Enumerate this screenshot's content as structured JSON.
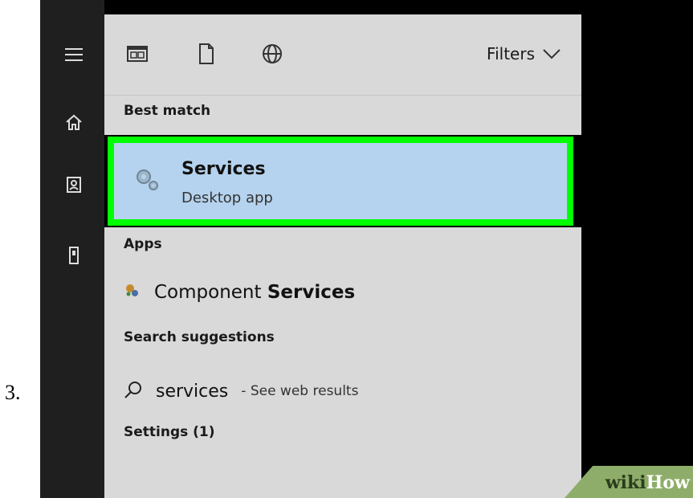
{
  "step_number": "3.",
  "rail_icons": [
    "hamburger-menu-icon",
    "home-icon",
    "contact-icon",
    "tower-icon"
  ],
  "toolbar": {
    "icons": [
      "apps-icon",
      "document-icon",
      "globe-icon"
    ],
    "filters_label": "Filters"
  },
  "sections": {
    "best_match": "Best match",
    "apps": "Apps",
    "search_suggestions": "Search suggestions",
    "settings": "Settings (1)"
  },
  "best_match_item": {
    "title": "Services",
    "subtitle": "Desktop app",
    "highlight_color": "#00ff00",
    "background_color": "#b5d3ee"
  },
  "apps_item": {
    "prefix": "Component ",
    "match": "Services"
  },
  "suggestion": {
    "query": "services",
    "hint": "- See web results"
  },
  "watermark": {
    "part1": "wiki",
    "part2": "How"
  }
}
